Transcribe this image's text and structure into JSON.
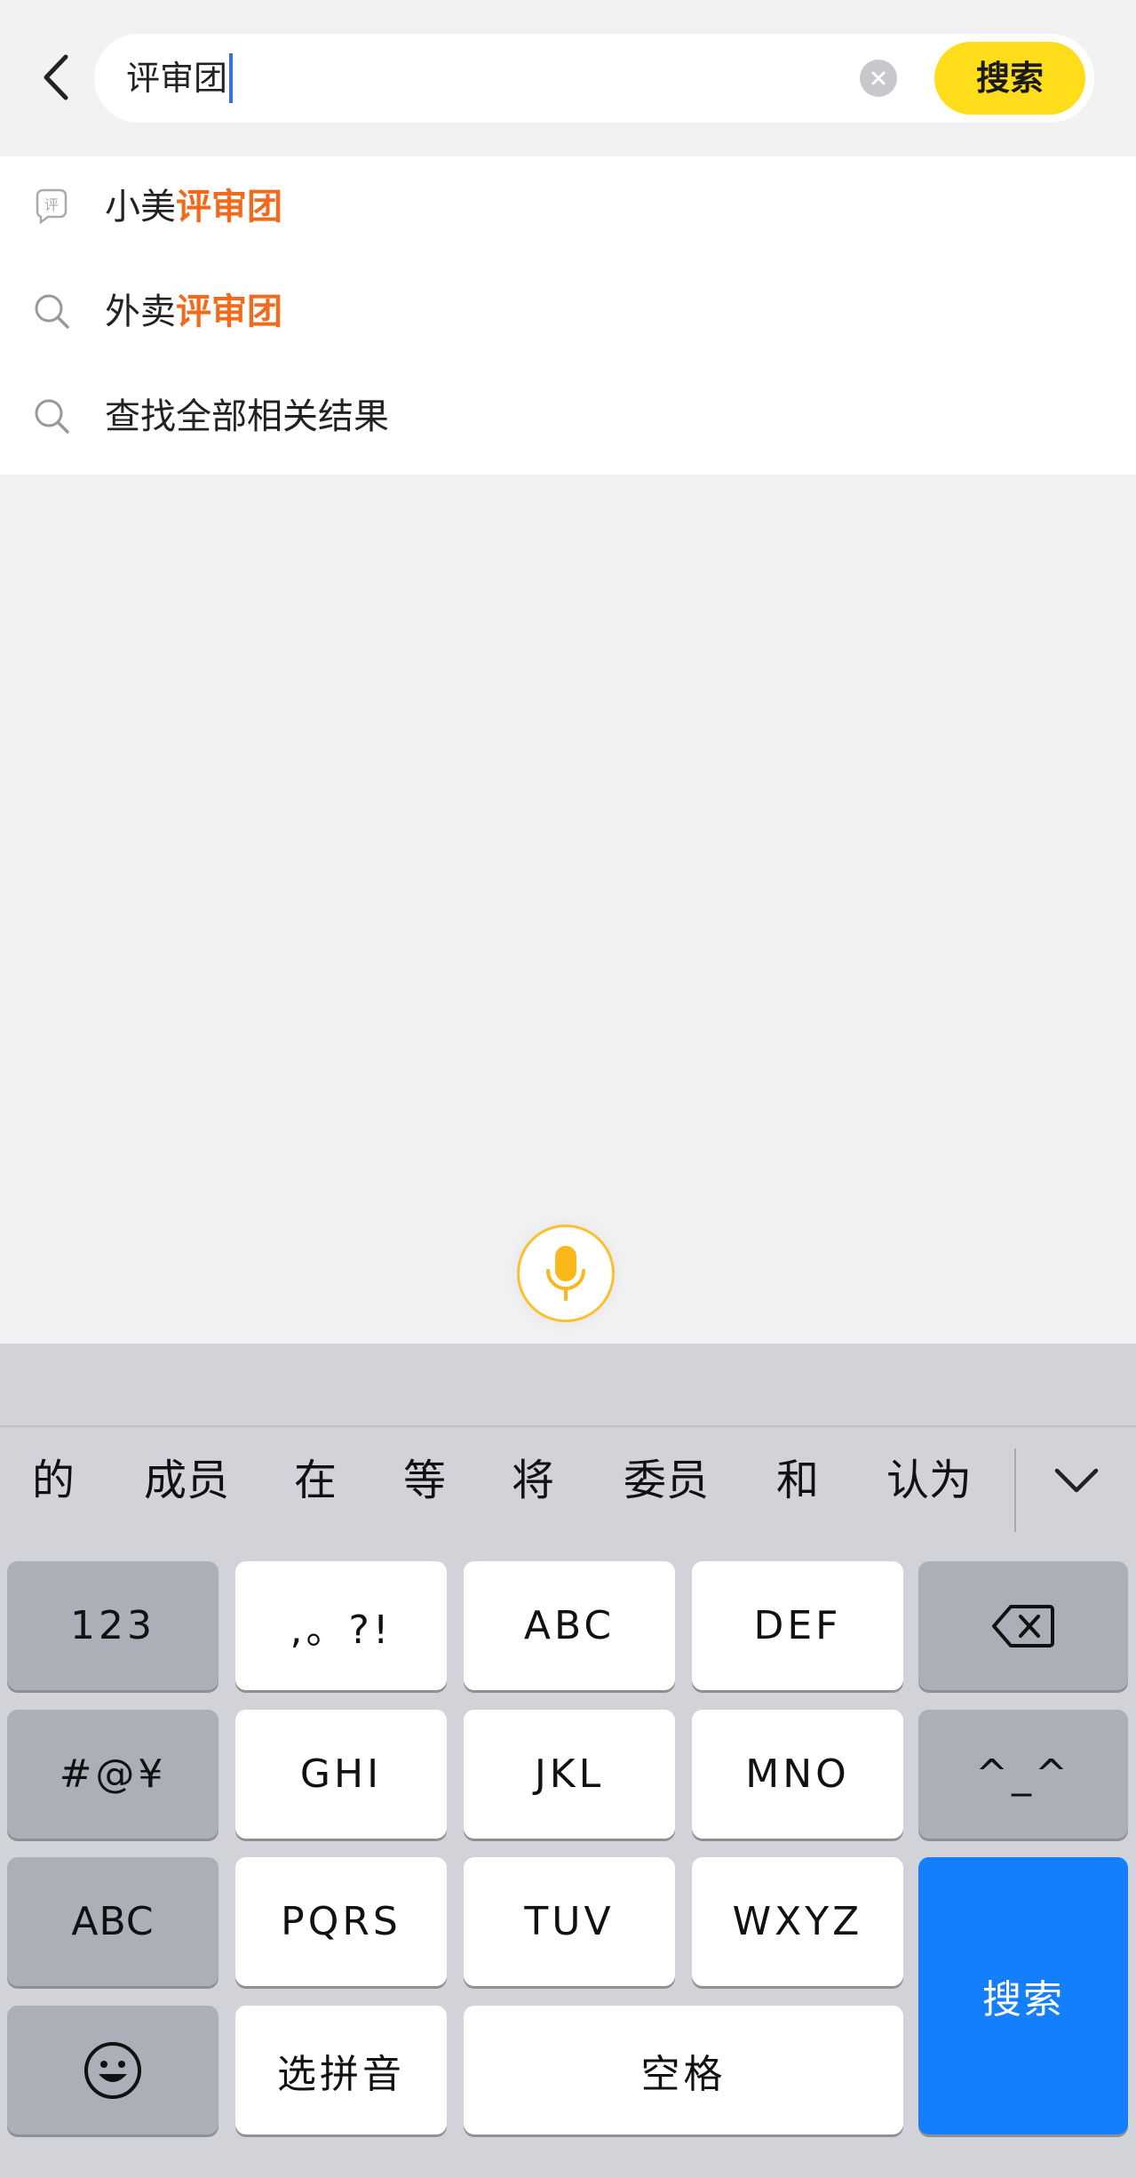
{
  "search": {
    "query": "评审团",
    "button_label": "搜索"
  },
  "suggestions": [
    {
      "prefix": "小美",
      "highlight": "评审团",
      "icon": "review-badge-icon"
    },
    {
      "prefix": "外卖",
      "highlight": "评审团",
      "icon": "search-icon"
    },
    {
      "prefix": "查找全部相关结果",
      "highlight": "",
      "icon": "search-icon"
    }
  ],
  "keyboard": {
    "candidates": [
      "的",
      "成员",
      "在",
      "等",
      "将",
      "委员",
      "和",
      "认为"
    ],
    "keys": {
      "numbers": "123",
      "punct": ",。?!",
      "abc": "ABC",
      "def": "DEF",
      "symbols": "#@¥",
      "ghi": "GHI",
      "jkl": "JKL",
      "mno": "MNO",
      "emoticon_face": "^_^",
      "abc_switch": "ABC",
      "pqrs": "PQRS",
      "tuv": "TUV",
      "wxyz": "WXYZ",
      "search": "搜索",
      "pinyin": "选拼音",
      "space": "空格"
    }
  },
  "colors": {
    "accent_yellow": "#ffdd1a",
    "highlight_orange": "#f26b1d",
    "keyboard_blue": "#157efb"
  }
}
